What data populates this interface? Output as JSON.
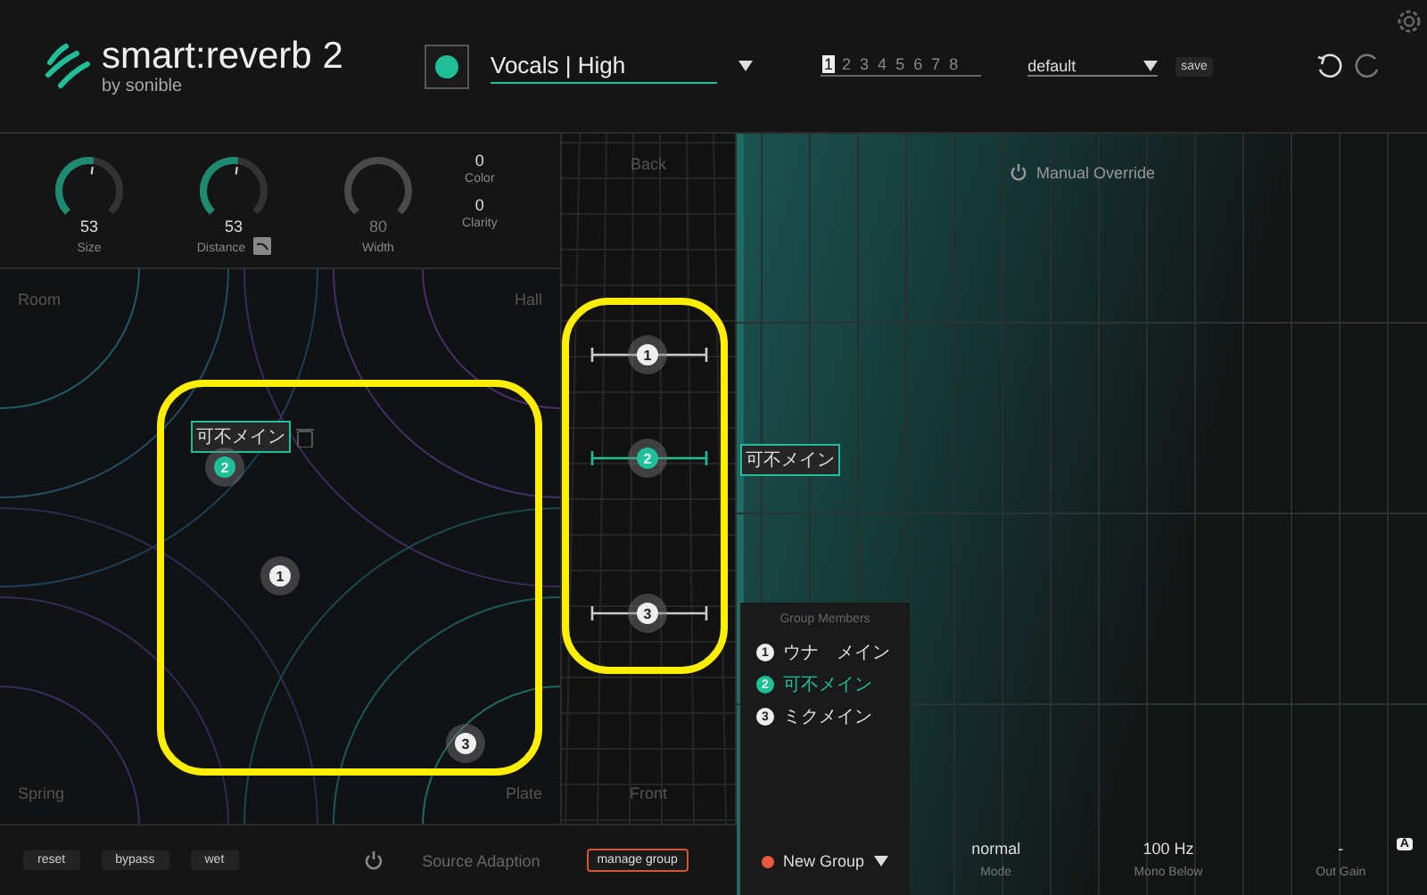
{
  "logo": {
    "name": "smart:reverb",
    "version": "2",
    "by": "by",
    "brand": "sonible"
  },
  "record": {
    "on": true
  },
  "preset": {
    "value": "Vocals | High"
  },
  "slots": [
    {
      "label": "1",
      "selected": true
    },
    {
      "label": "2",
      "selected": false
    },
    {
      "label": "3",
      "selected": false
    },
    {
      "label": "4",
      "selected": false
    },
    {
      "label": "5",
      "selected": false
    },
    {
      "label": "6",
      "selected": false
    },
    {
      "label": "7",
      "selected": false
    },
    {
      "label": "8",
      "selected": false
    }
  ],
  "profile": {
    "value": "default",
    "save": "save"
  },
  "knobs": [
    {
      "label": "Size",
      "value": "53",
      "level": 0.53,
      "disabled": false,
      "link": false
    },
    {
      "label": "Distance",
      "value": "53",
      "level": 0.53,
      "disabled": false,
      "link": true
    },
    {
      "label": "Width",
      "value": "80",
      "disabled": true,
      "link": false
    }
  ],
  "values": [
    {
      "label": "Color",
      "value": "0"
    },
    {
      "label": "Clarity",
      "value": "0"
    }
  ],
  "pad": {
    "corners": [
      "Room",
      "Hall",
      "Spring",
      "Plate"
    ],
    "tag": "可不メイン"
  },
  "pad_nodes": [
    {
      "number": "1",
      "selected": false
    },
    {
      "number": "2",
      "selected": true
    },
    {
      "number": "3",
      "selected": false
    }
  ],
  "depth": {
    "back": "Back",
    "front": "Front",
    "tag": "可不メイン"
  },
  "depth_nodes": [
    {
      "number": "1",
      "selected": false
    },
    {
      "number": "2",
      "selected": true
    },
    {
      "number": "3",
      "selected": false
    }
  ],
  "manual_override": {
    "label": "Manual Override"
  },
  "group_members": {
    "title": "Group Members",
    "items": [
      {
        "number": "1",
        "name": "ウナ　メイン",
        "selected": false
      },
      {
        "number": "2",
        "name": "可不メイン",
        "selected": true
      },
      {
        "number": "3",
        "name": "ミクメイン",
        "selected": false
      }
    ]
  },
  "group": {
    "name": "New Group",
    "color": "#e8593f"
  },
  "footer_buttons": [
    "reset",
    "bypass",
    "wet"
  ],
  "source_adaption": {
    "label": "Source Adaption",
    "on": false
  },
  "manage_group": "manage group",
  "outputs": [
    {
      "value": "normal",
      "label": "Mode"
    },
    {
      "value": "100 Hz",
      "label": "Mono Below"
    },
    {
      "value": "-",
      "label": "Out Gain"
    }
  ],
  "auto_badge": "A"
}
